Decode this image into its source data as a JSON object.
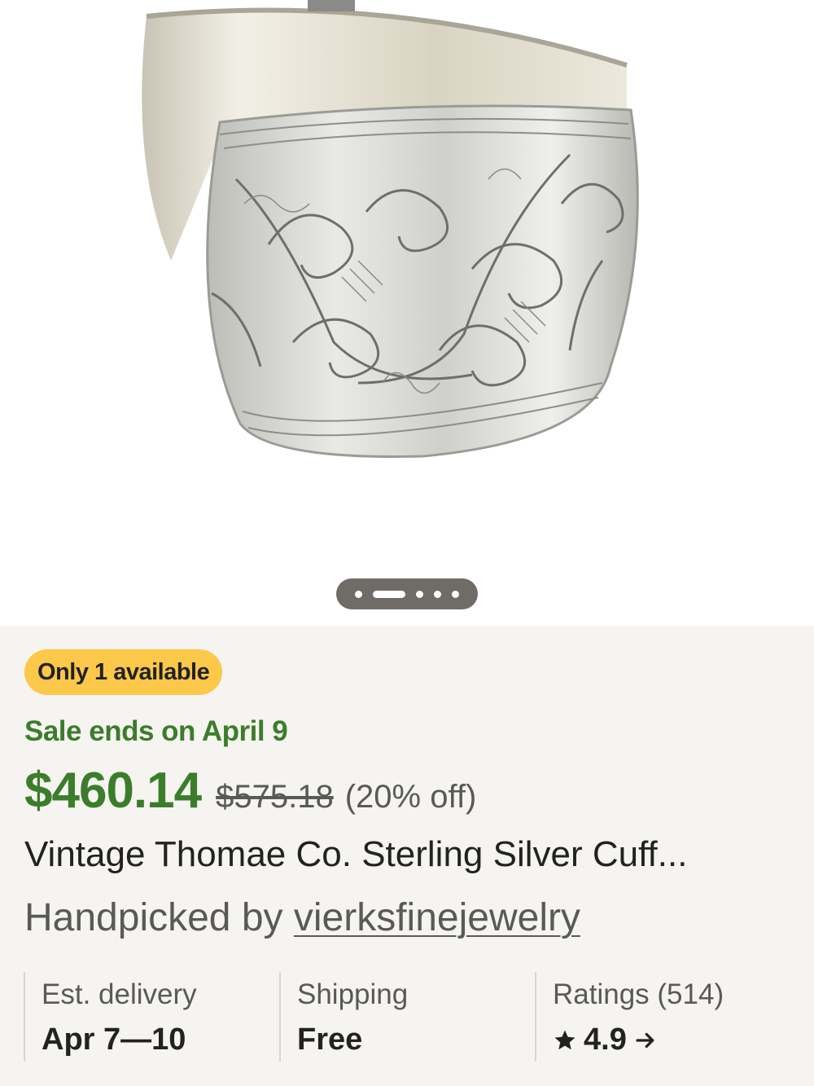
{
  "product_image": {
    "alt": "",
    "pager": {
      "count": 5,
      "active_index": 1
    }
  },
  "availability_badge": "Only 1 available",
  "sale_text": "Sale ends on April 9",
  "price": {
    "current": "$460.14",
    "original": "$575.18",
    "discount": "(20% off)",
    "color": "#3b7d2b"
  },
  "title": "Vintage Thomae Co. Sterling Silver Cuff...",
  "handpicked": {
    "prefix": "Handpicked by ",
    "seller": "vierksfinejewelry"
  },
  "stats": {
    "delivery": {
      "label": "Est. delivery",
      "value": "Apr 7—10"
    },
    "shipping": {
      "label": "Shipping",
      "value": "Free"
    },
    "ratings": {
      "label": "Ratings (514)",
      "value": "4.9",
      "icon": "star-icon",
      "arrow": "arrow-right-icon"
    }
  },
  "colors": {
    "badge": "#fcc84a",
    "panel": "#f6f4f0",
    "sale_green": "#3b7d2b"
  }
}
